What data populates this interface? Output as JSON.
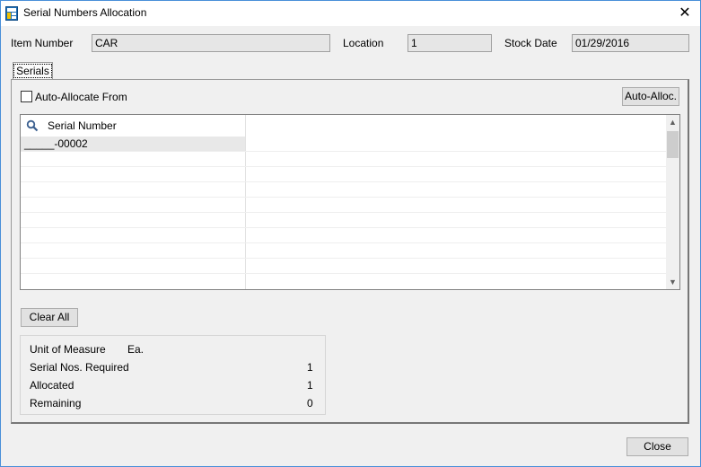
{
  "window": {
    "title": "Serial Numbers Allocation",
    "close_glyph": "✕"
  },
  "header": {
    "item_number_label": "Item Number",
    "item_number_value": "CAR",
    "location_label": "Location",
    "location_value": "1",
    "stock_date_label": "Stock Date",
    "stock_date_value": "01/29/2016"
  },
  "tabs": [
    {
      "label": "Serials"
    }
  ],
  "serials": {
    "auto_allocate_label": "Auto-Allocate From",
    "auto_allocate_checked": false,
    "auto_alloc_button": "Auto-Alloc.",
    "grid": {
      "column_header": "Serial Number",
      "rows": [
        "_____-00002",
        "",
        "",
        "",
        "",
        "",
        "",
        "",
        ""
      ]
    },
    "clear_all_button": "Clear All"
  },
  "summary": {
    "unit_of_measure_label": "Unit of Measure",
    "unit_of_measure_value": "Ea.",
    "required_label": "Serial Nos. Required",
    "required_value": "1",
    "allocated_label": "Allocated",
    "allocated_value": "1",
    "remaining_label": "Remaining",
    "remaining_value": "0"
  },
  "footer": {
    "close_button": "Close"
  },
  "colors": {
    "window_border": "#4a90d9",
    "readonly_field": "#e6e6e6",
    "button_face": "#e1e1e1",
    "selected_row": "#e8e8e8"
  },
  "icons": [
    "app-icon",
    "close-icon",
    "search-icon",
    "scroll-up-icon",
    "scroll-down-icon"
  ]
}
